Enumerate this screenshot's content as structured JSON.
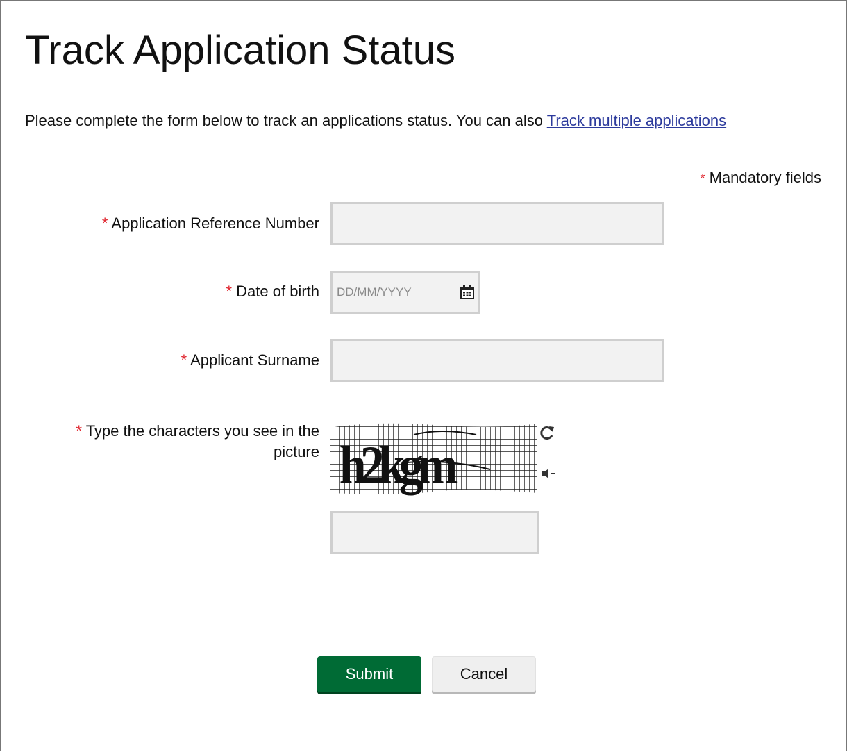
{
  "page": {
    "title": "Track Application Status",
    "intro_text": "Please complete the form below to track an applications status. You can also ",
    "intro_link": "Track multiple applications",
    "mandatory_note": "Mandatory fields",
    "required_marker": "*"
  },
  "form": {
    "reference": {
      "label": "Application Reference Number",
      "value": ""
    },
    "dob": {
      "label": "Date of birth",
      "value": "",
      "placeholder": "DD/MM/YYYY"
    },
    "surname": {
      "label": "Applicant Surname",
      "value": ""
    },
    "captcha": {
      "label": "Type the characters you see in the picture",
      "value": "",
      "image_text": "h2kgm"
    }
  },
  "buttons": {
    "submit": "Submit",
    "cancel": "Cancel"
  },
  "colors": {
    "accent_green": "#006b35",
    "required_red": "#e0262f",
    "link_blue": "#2c3a9c",
    "field_bg": "#f2f2f2"
  },
  "icons": {
    "calendar": "calendar-icon",
    "refresh": "refresh-icon",
    "audio": "audio-icon"
  }
}
